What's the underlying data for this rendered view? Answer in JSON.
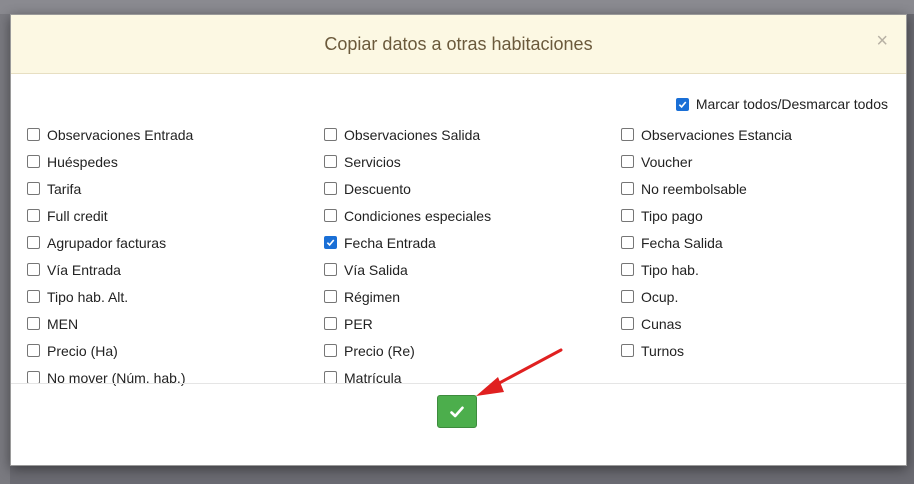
{
  "modal": {
    "title": "Copiar datos a otras habitaciones",
    "close_glyph": "×",
    "toggle_all": {
      "label": "Marcar todos/Desmarcar todos",
      "checked": true
    },
    "options": [
      {
        "label": "Observaciones Entrada",
        "checked": false
      },
      {
        "label": "Observaciones Salida",
        "checked": false
      },
      {
        "label": "Observaciones Estancia",
        "checked": false
      },
      {
        "label": "Huéspedes",
        "checked": false
      },
      {
        "label": "Servicios",
        "checked": false
      },
      {
        "label": "Voucher",
        "checked": false
      },
      {
        "label": "Tarifa",
        "checked": false
      },
      {
        "label": "Descuento",
        "checked": false
      },
      {
        "label": "No reembolsable",
        "checked": false
      },
      {
        "label": "Full credit",
        "checked": false
      },
      {
        "label": "Condiciones especiales",
        "checked": false
      },
      {
        "label": "Tipo pago",
        "checked": false
      },
      {
        "label": "Agrupador facturas",
        "checked": false
      },
      {
        "label": "Fecha Entrada",
        "checked": true
      },
      {
        "label": "Fecha Salida",
        "checked": false
      },
      {
        "label": "Vía Entrada",
        "checked": false
      },
      {
        "label": "Vía Salida",
        "checked": false
      },
      {
        "label": "Tipo hab.",
        "checked": false
      },
      {
        "label": "Tipo hab. Alt.",
        "checked": false
      },
      {
        "label": "Régimen",
        "checked": false
      },
      {
        "label": "Ocup.",
        "checked": false
      },
      {
        "label": "MEN",
        "checked": false
      },
      {
        "label": "PER",
        "checked": false
      },
      {
        "label": "Cunas",
        "checked": false
      },
      {
        "label": "Precio (Ha)",
        "checked": false
      },
      {
        "label": "Precio (Re)",
        "checked": false
      },
      {
        "label": "Turnos",
        "checked": false
      },
      {
        "label": "No mover (Núm. hab.)",
        "checked": false
      },
      {
        "label": "Matrícula",
        "checked": false
      }
    ],
    "confirm_icon": "check-icon",
    "colors": {
      "header_bg": "#fcf8e3",
      "title": "#6b5a3c",
      "checkbox_checked": "#1a6fd6",
      "confirm_button": "#4cae4c",
      "annotation_arrow": "#e02020"
    }
  }
}
